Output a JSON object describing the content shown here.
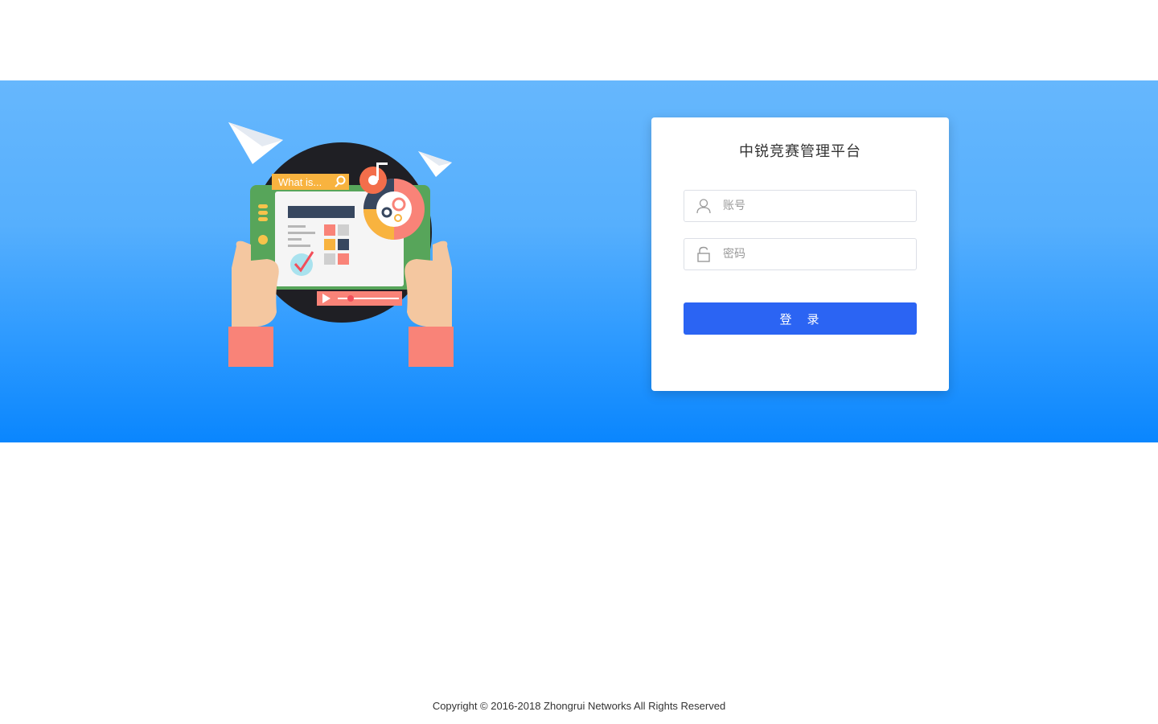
{
  "login": {
    "title": "中锐竞赛管理平台",
    "username_placeholder": "账号",
    "password_placeholder": "密码",
    "submit_label": "登　录"
  },
  "illustration": {
    "search_text": "What is..."
  },
  "footer": {
    "copyright": "Copyright © 2016-2018 Zhongrui Networks All Rights Reserved"
  },
  "colors": {
    "banner_top": "#66b7fd",
    "banner_bottom": "#0a86fe",
    "button": "#2b64f3"
  }
}
